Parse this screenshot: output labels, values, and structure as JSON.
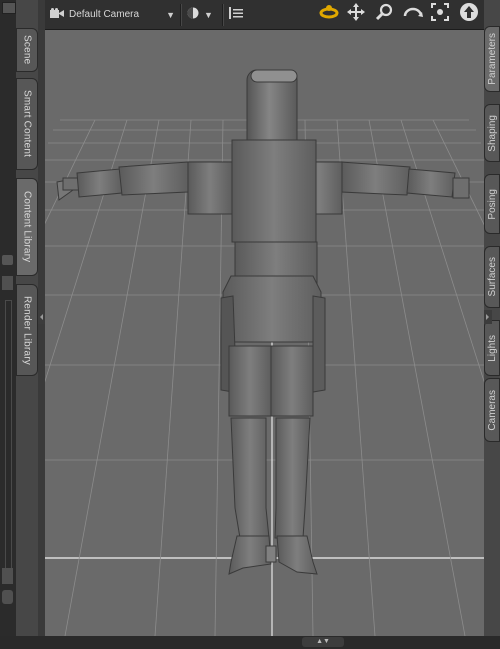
{
  "left_tabs": [
    {
      "label": "Scene",
      "active": false
    },
    {
      "label": "Smart Content",
      "active": false
    },
    {
      "label": "Content Library",
      "active": true
    },
    {
      "label": "Render Library",
      "active": false
    }
  ],
  "right_tabs": [
    {
      "label": "Parameters",
      "active": true
    },
    {
      "label": "Shaping",
      "active": false
    },
    {
      "label": "Posing",
      "active": false
    },
    {
      "label": "Surfaces",
      "active": false
    },
    {
      "label": "Lights",
      "active": false
    },
    {
      "label": "Cameras",
      "active": false
    }
  ],
  "toolbar": {
    "camera_label": "Default Camera",
    "tools": [
      "orbit-icon",
      "pan-icon",
      "zoom-icon",
      "rotate-icon",
      "frame-icon",
      "reset-icon"
    ]
  },
  "colors": {
    "viewport_bg": "#6a6a6a",
    "grid": "#8c8c8c",
    "accent": "#e0a800"
  }
}
